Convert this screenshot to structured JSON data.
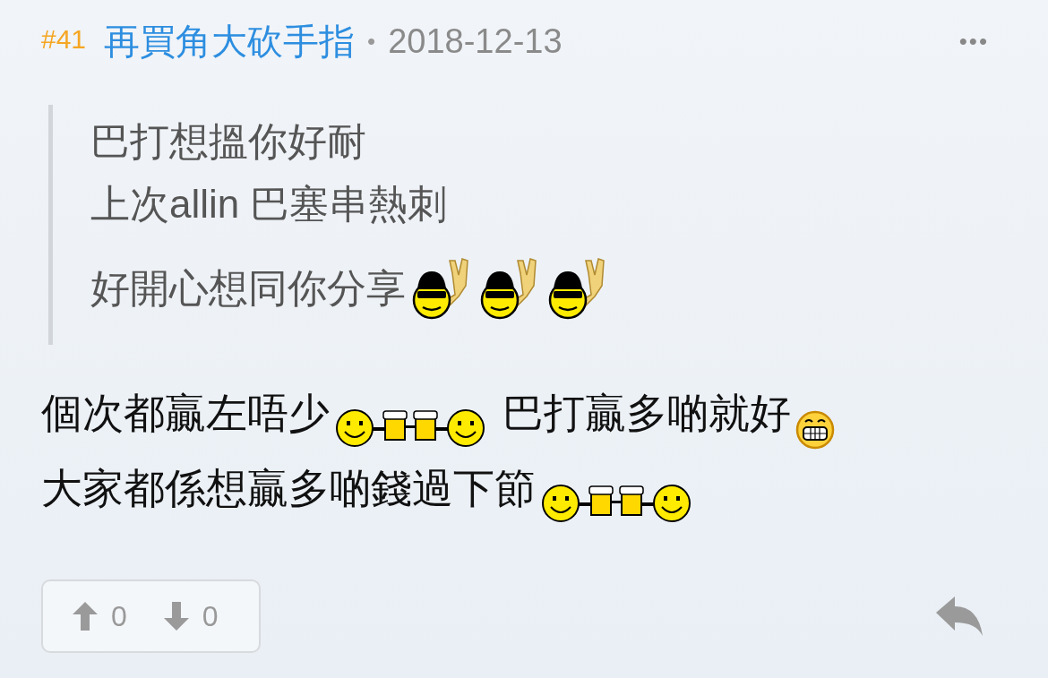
{
  "post": {
    "number": "#41",
    "username": "再買角大砍手指",
    "separator": "•",
    "date": "2018-12-13",
    "more": "•••"
  },
  "quote": {
    "lines": [
      [
        {
          "kind": "text",
          "text": "巴打想搵你好耐"
        }
      ],
      [
        {
          "kind": "text",
          "text": "上次allin 巴塞串熱刺"
        }
      ],
      [
        {
          "kind": "text",
          "text": "好開心想同你分享"
        },
        {
          "kind": "cool"
        },
        {
          "kind": "cool"
        },
        {
          "kind": "cool"
        }
      ]
    ]
  },
  "body": {
    "lines": [
      [
        {
          "kind": "text",
          "text": "個次都贏左唔少"
        },
        {
          "kind": "toast"
        },
        {
          "kind": "text",
          "text": " 巴打贏多啲就好"
        },
        {
          "kind": "grin"
        }
      ],
      [
        {
          "kind": "text",
          "text": "大家都係想贏多啲錢過下節"
        },
        {
          "kind": "toast"
        }
      ]
    ]
  },
  "votes": {
    "up": "0",
    "down": "0"
  }
}
